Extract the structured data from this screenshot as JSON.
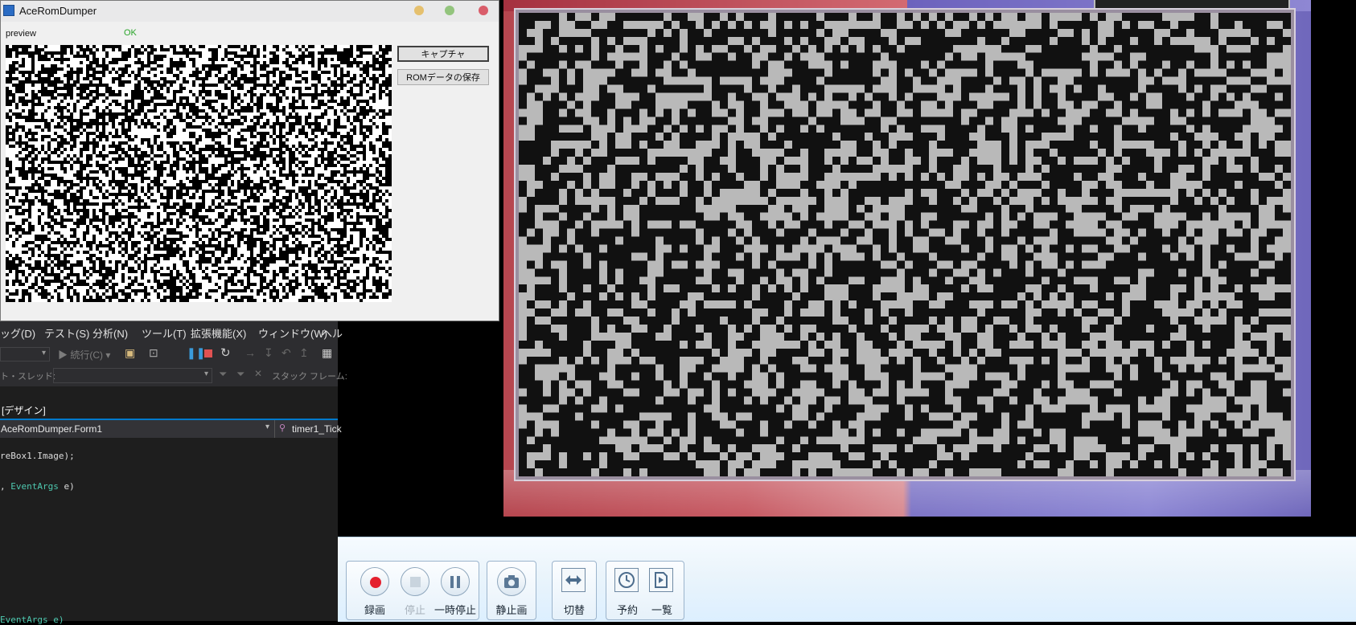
{
  "app_window": {
    "title": "AceRomDumper",
    "preview_label": "preview",
    "status_text": "OK",
    "status_color": "#2aa52a",
    "capture_button": "キャプチャ",
    "save_rom_button": "ROMデータの保存",
    "window_controls": [
      "minimize-dot",
      "maximize-dot",
      "close-dot"
    ],
    "control_colors": {
      "minimize": "#e5c06e",
      "maximize": "#93c47d",
      "close": "#d95d6a"
    }
  },
  "ide": {
    "menu": [
      "ッグ(D)",
      "テスト(S)",
      "分析(N)",
      "ツール(T)",
      "拡張機能(X)",
      "ウィンドウ(W)",
      "ヘル"
    ],
    "toolbar1": {
      "continue_label": "続行(C)"
    },
    "toolbar2": {
      "thread_label": "ト・スレッド:",
      "stack_frame_label": "スタック フレーム:"
    },
    "design_tab": "[デザイン]",
    "nav_class": "AceRomDumper.Form1",
    "nav_member": "timer1_Tick",
    "code_lines": [
      "reBox1.Image);",
      "EventArgs",
      "e)",
      "EventArgs e)"
    ]
  },
  "recorder": {
    "buttons": {
      "record": "録画",
      "stop": "停止",
      "pause": "一時停止",
      "still": "静止画",
      "switch": "切替",
      "schedule": "予約",
      "list": "一覧"
    },
    "record_color": "#e4202e"
  }
}
